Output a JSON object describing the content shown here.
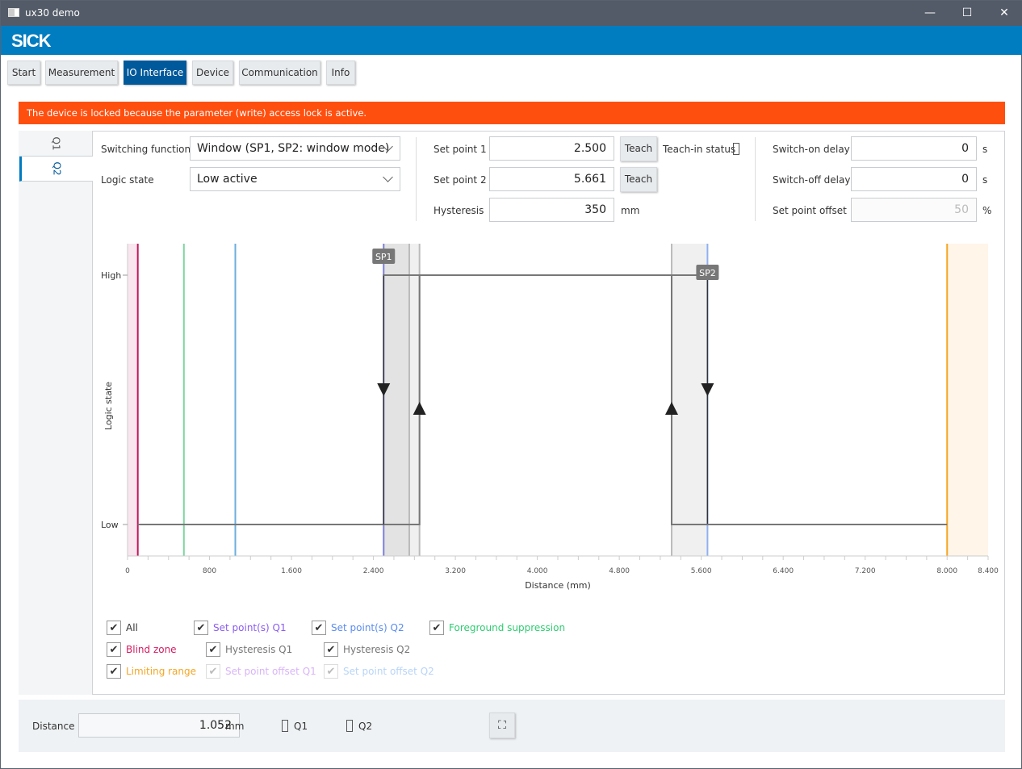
{
  "window": {
    "title": "ux30 demo",
    "controls": [
      "minimize",
      "maximize",
      "close"
    ]
  },
  "brand": {
    "logo": "SICK",
    "color": "#007cc1"
  },
  "tabs": [
    {
      "label": "Start"
    },
    {
      "label": "Measurement"
    },
    {
      "label": "IO Interface",
      "active": true
    },
    {
      "label": "Device"
    },
    {
      "label": "Communication"
    },
    {
      "label": "Info"
    }
  ],
  "lock_message": "The device is locked because the parameter (write) access lock is active.",
  "side_tabs": [
    {
      "label": "Q1"
    },
    {
      "label": "Q2",
      "active": true
    }
  ],
  "form": {
    "switching_function": {
      "label": "Switching function",
      "value": "Window (SP1, SP2: window mode)"
    },
    "logic_state": {
      "label": "Logic state",
      "value": "Low active"
    },
    "set_point_1": {
      "label": "Set point 1",
      "value": "2.500",
      "button": "Teach"
    },
    "set_point_2": {
      "label": "Set point 2",
      "value": "5.661",
      "button": "Teach"
    },
    "teach_status": {
      "label": "Teach-in status"
    },
    "hysteresis": {
      "label": "Hysteresis",
      "value": "350",
      "unit": "mm"
    },
    "switch_on_delay": {
      "label": "Switch-on delay",
      "value": "0",
      "unit": "s"
    },
    "switch_off_delay": {
      "label": "Switch-off delay",
      "value": "0",
      "unit": "s"
    },
    "set_point_offset": {
      "label": "Set point offset",
      "value": "50",
      "unit": "%",
      "disabled": true
    }
  },
  "chart_data": {
    "type": "line",
    "xlabel": "Distance (mm)",
    "ylabel": "Logic state",
    "xlim": [
      0,
      8400
    ],
    "xticks": [
      "0",
      "800",
      "1.600",
      "2.400",
      "3.200",
      "4.000",
      "4.800",
      "5.600",
      "6.400",
      "7.200",
      "8.000",
      "8.400"
    ],
    "xtick_values": [
      0,
      800,
      1600,
      2400,
      3200,
      4000,
      4800,
      5600,
      6400,
      7200,
      8000,
      8400
    ],
    "yticks": [
      "High",
      "Low"
    ],
    "markers": {
      "sp1_label": "SP1",
      "sp2_label": "SP2"
    },
    "blind_zone": 100,
    "foreground_suppression": 550,
    "distance": 1052,
    "sp1": 2500,
    "sp2": 5661,
    "hysteresis": 350,
    "sp1_offset_line": 2750,
    "limiting_range": 8000,
    "colors": {
      "blind": "#c2185b",
      "foreground": "#7fd6a0",
      "distance": "#6aaede",
      "limiting": "#f5a623",
      "sp1": "#7b7fd8",
      "sp2": "#8fb0f0"
    }
  },
  "legend": [
    {
      "label": "All",
      "color": "#333",
      "checked": true
    },
    {
      "label": "Set point(s) Q1",
      "color": "#8a5cf0",
      "checked": true
    },
    {
      "label": "Set point(s) Q2",
      "color": "#5a8cf0",
      "checked": true
    },
    {
      "label": "Foreground suppression",
      "color": "#2ecc71",
      "checked": true
    },
    {
      "label": "Blind zone",
      "color": "#d81b60",
      "checked": true
    },
    {
      "label": "Hysteresis Q1",
      "color": "#777",
      "checked": true
    },
    {
      "label": "Hysteresis Q2",
      "color": "#777",
      "checked": true
    },
    {
      "label": "Limiting range",
      "color": "#f5a623",
      "checked": true
    },
    {
      "label": "Set point offset Q1",
      "color": "#d8b4f8",
      "checked": true,
      "disabled": true
    },
    {
      "label": "Set point offset Q2",
      "color": "#b8d4f8",
      "checked": true,
      "disabled": true
    }
  ],
  "bottom": {
    "distance_label": "Distance",
    "distance_value": "1.052",
    "unit": "mm",
    "q1": "Q1",
    "q2": "Q2"
  }
}
